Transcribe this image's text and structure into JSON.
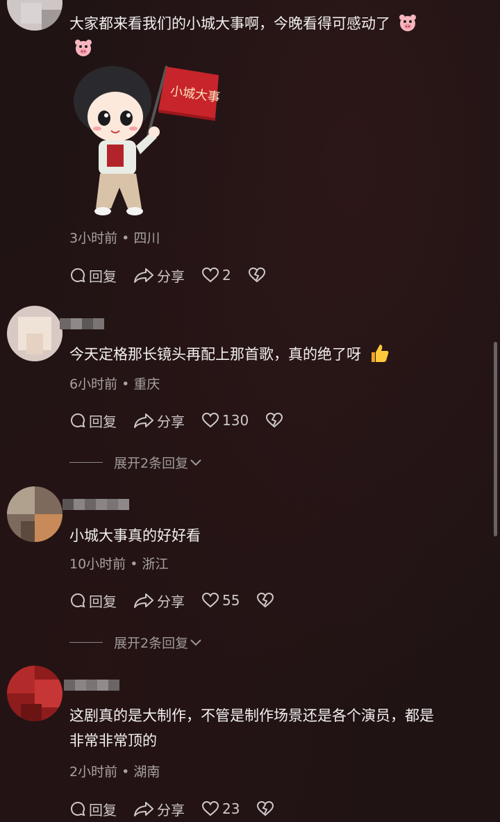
{
  "comments": [
    {
      "text": "大家都来看我们的小城大事啊，今晚看得可感动了",
      "sticker_text": "小城大事",
      "time": "3小时前",
      "location": "四川",
      "likes": "2"
    },
    {
      "text": "今天定格那长镜头再配上那首歌，真的绝了呀",
      "time": "6小时前",
      "location": "重庆",
      "likes": "130",
      "expand": "展开2条回复"
    },
    {
      "text": "小城大事真的好好看",
      "time": "10小时前",
      "location": "浙江",
      "likes": "55",
      "expand": "展开2条回复"
    },
    {
      "text": "这剧真的是大制作，不管是制作场景还是各个演员，都是",
      "text_line2": "非常非常顶的",
      "time": "2小时前",
      "location": "湖南",
      "likes": "23"
    }
  ],
  "labels": {
    "reply": "回复",
    "share": "分享",
    "dot": "•"
  },
  "colors": {
    "background": "#1f1314",
    "text": "#f2f0f0",
    "meta": "#a9a3a3",
    "flag": "#c8242b"
  }
}
